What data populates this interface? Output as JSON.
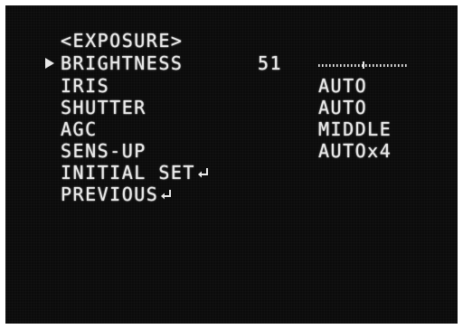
{
  "menu": {
    "title": "<EXPOSURE>",
    "items": [
      {
        "label": "BRIGHTNESS",
        "number": "51",
        "value": ""
      },
      {
        "label": "IRIS",
        "value": "AUTO"
      },
      {
        "label": "SHUTTER",
        "value": "AUTO"
      },
      {
        "label": "AGC",
        "value": "MIDDLE"
      },
      {
        "label": "SENS-UP",
        "value": "AUTOx4"
      },
      {
        "label": "INITIAL SET",
        "value": ""
      },
      {
        "label": "PREVIOUS",
        "value": ""
      }
    ],
    "brightness_level": 51,
    "brightness_max": 100,
    "selected_item": "BRIGHTNESS"
  },
  "icons": {
    "cursor": "selection-arrow-icon",
    "enter": "enter-return-icon"
  },
  "colors": {
    "background": "#0b0b0b",
    "text": "#e9e9e9",
    "frame": "#ffffff"
  }
}
